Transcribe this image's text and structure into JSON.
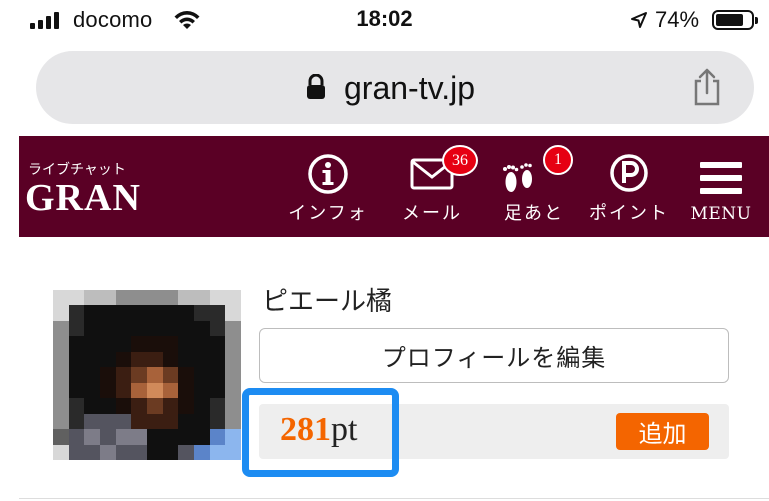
{
  "status_bar": {
    "carrier": "docomo",
    "time": "18:02",
    "battery_percent": "74%",
    "icons": [
      "signal-icon",
      "wifi-icon",
      "location-arrow-icon",
      "battery-icon"
    ]
  },
  "browser": {
    "url": "gran-tv.jp",
    "icons": [
      "lock-icon",
      "share-icon"
    ]
  },
  "header": {
    "logo_sub": "ライブチャット",
    "logo": "GRAN",
    "background_color": "#5a0025",
    "nav": [
      {
        "label": "インフォ",
        "icon": "info-icon"
      },
      {
        "label": "メール",
        "icon": "mail-icon",
        "badge": "36"
      },
      {
        "label": "足あと",
        "icon": "footprints-icon",
        "badge": "1"
      },
      {
        "label": "ポイント",
        "icon": "point-icon"
      },
      {
        "label": "MENU",
        "icon": "hamburger-menu-icon"
      }
    ]
  },
  "profile": {
    "name": "ピエール橘",
    "edit_button": "プロフィールを編集",
    "points_value": "281",
    "points_unit": "pt",
    "add_button": "追加",
    "accent_color": "#f46500",
    "highlight_color": "#1d8cf2"
  }
}
